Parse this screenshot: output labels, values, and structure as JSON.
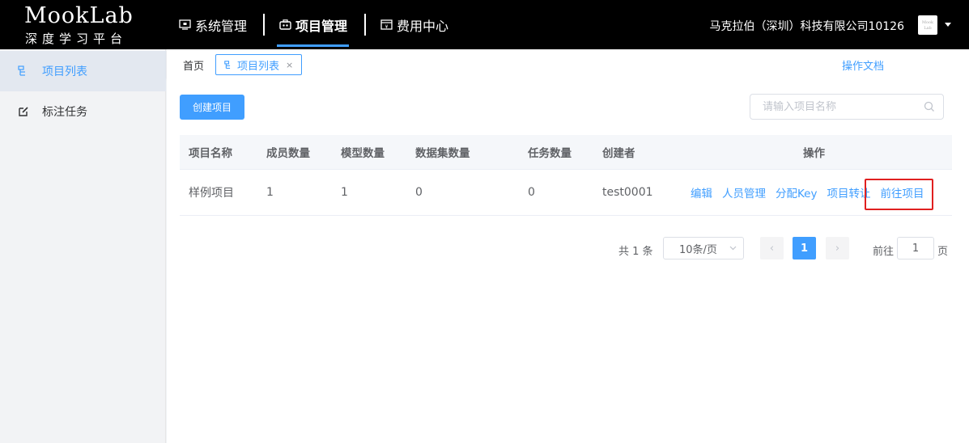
{
  "app": {
    "logo_main": "MookLab",
    "logo_sub": "深度学习平台",
    "company": "马克拉伯（深圳）科技有限公司10126",
    "avatar_text": "Mook Lab"
  },
  "top_nav": [
    {
      "label": "系统管理",
      "icon": "monitor-icon"
    },
    {
      "label": "项目管理",
      "icon": "briefcase-icon",
      "active": true
    },
    {
      "label": "费用中心",
      "icon": "wallet-icon"
    }
  ],
  "sidebar": {
    "items": [
      {
        "label": "项目列表",
        "icon": "project-tree-icon",
        "active": true
      },
      {
        "label": "标注任务",
        "icon": "edit-icon"
      }
    ]
  },
  "tabs": {
    "home": "首页",
    "current": "项目列表",
    "close": "×",
    "docs_link": "操作文档"
  },
  "toolbar": {
    "create_label": "创建项目",
    "search_placeholder": "请输入项目名称"
  },
  "table": {
    "headers": [
      "项目名称",
      "成员数量",
      "模型数量",
      "数据集数量",
      "任务数量",
      "创建者",
      "操作"
    ],
    "rows": [
      {
        "cells": [
          "样例项目",
          "1",
          "1",
          "0",
          "0",
          "test0001"
        ],
        "actions": [
          "编辑",
          "人员管理",
          "分配Key",
          "项目转让",
          "前往项目"
        ]
      }
    ]
  },
  "pagination": {
    "total": "共 1 条",
    "page_size": "10条/页",
    "prev": "‹",
    "current": "1",
    "next": "›",
    "goto_label": "前往",
    "goto_value": "1",
    "unit": "页"
  },
  "colors": {
    "primary": "#409eff",
    "topbar": "#000000",
    "highlight": "#e02020"
  }
}
